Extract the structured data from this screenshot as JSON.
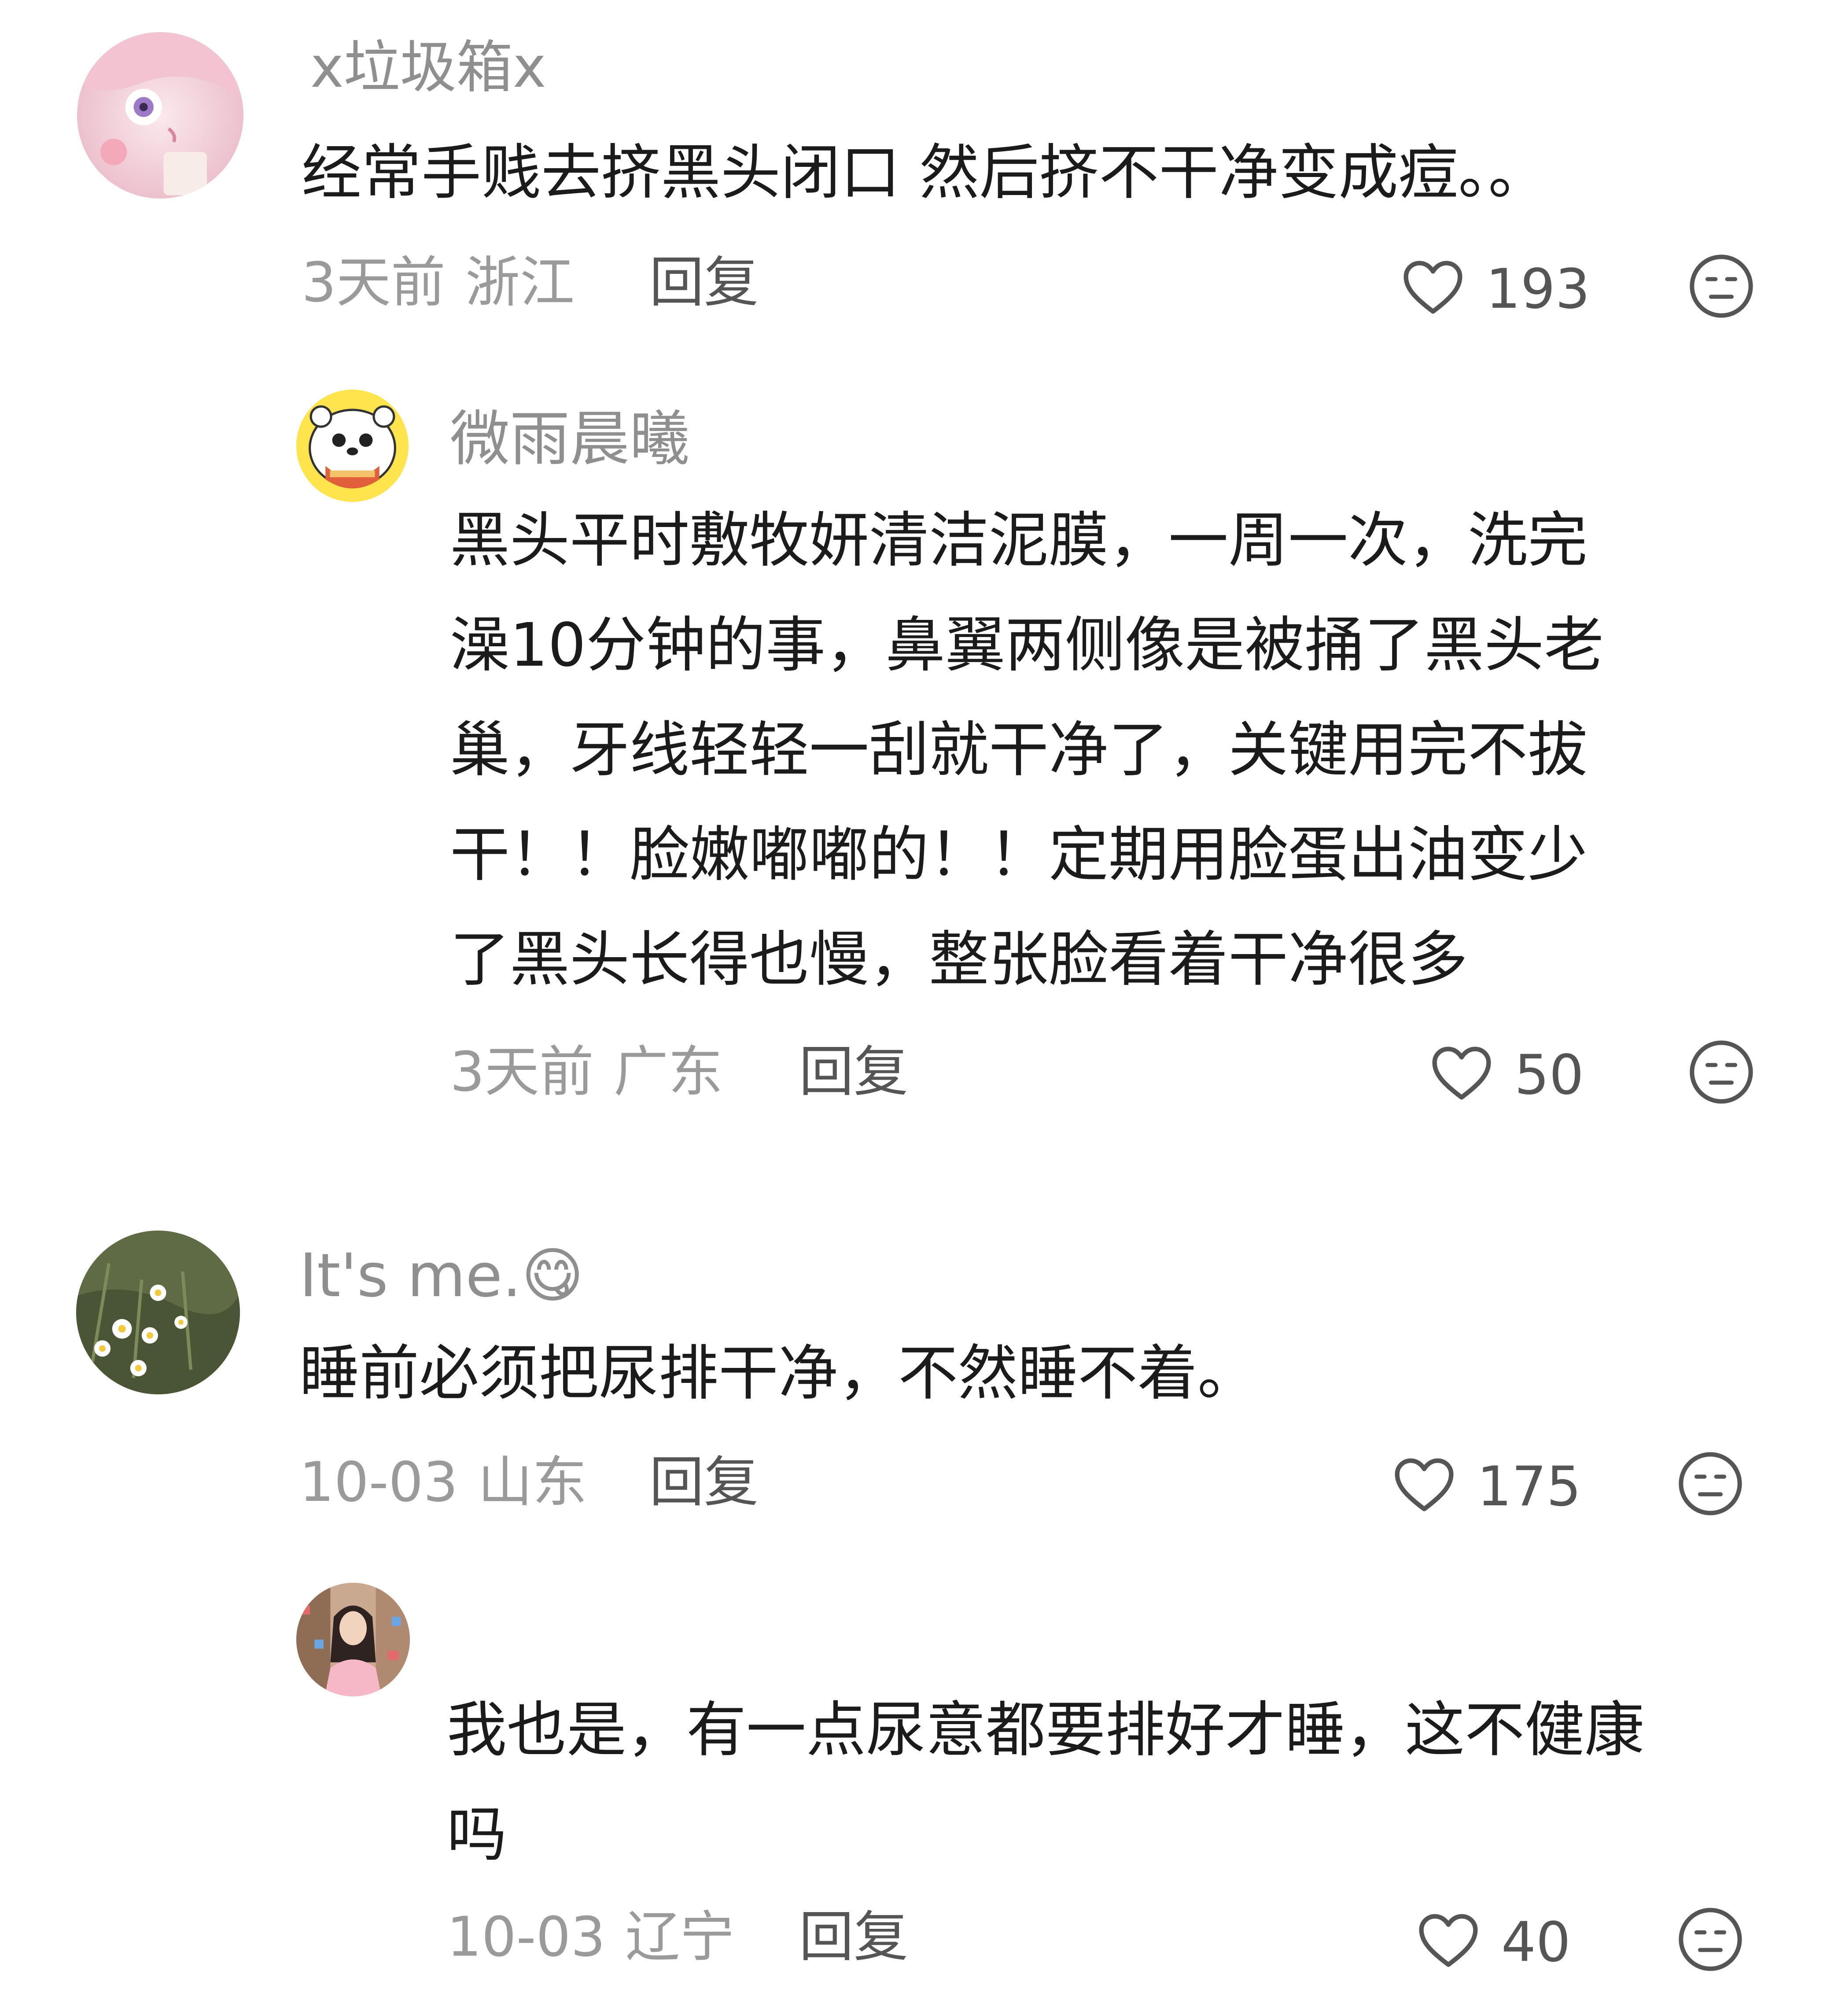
{
  "comments": [
    {
      "username": "x垃圾箱x",
      "text_lines": [
        "经常手贱去挤黑头闭口 然后挤不干净变成痘。。"
      ],
      "time": "3天前",
      "location": "浙江",
      "reply_label": "回复",
      "likes": "193",
      "replies": [
        {
          "username": "微雨晨曦",
          "text_lines": [
            "黑头平时敷牧妍清洁泥膜，一周一次，洗完",
            "澡10分钟的事，鼻翼两侧像是被捅了黑头老",
            "巢，牙线轻轻一刮就干净了，关键用完不拔",
            "干！！脸嫩嘟嘟的！！定期用脸蛋出油变少",
            "了黑头长得也慢，整张脸看着干净很多"
          ],
          "time": "3天前",
          "location": "广东",
          "reply_label": "回复",
          "likes": "50"
        }
      ]
    },
    {
      "username": "It's me.",
      "username_emoji": "😋",
      "text_lines": [
        "睡前必须把尿排干净，不然睡不着。"
      ],
      "time": "10-03",
      "location": "山东",
      "reply_label": "回复",
      "likes": "175",
      "replies": [
        {
          "username": "",
          "text_lines": [
            "我也是，有一点尿意都要排好才睡，这不健康",
            "吗"
          ],
          "time": "10-03",
          "location": "辽宁",
          "reply_label": "回复",
          "likes": "40"
        }
      ]
    }
  ],
  "icons": {
    "like": "heart-outline-icon",
    "dislike": "neutral-face-icon"
  },
  "colors": {
    "username": "#8f8f8f",
    "text": "#1b1b1b",
    "meta": "#9a9a9a",
    "action": "#555555"
  }
}
